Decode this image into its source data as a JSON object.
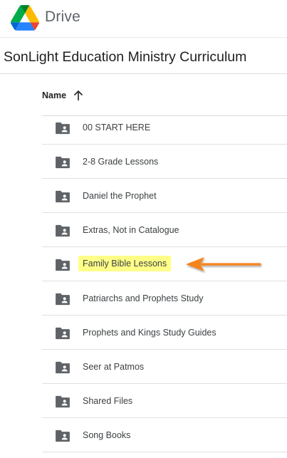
{
  "header": {
    "brand": "Drive",
    "logo_icon": "google-drive-logo"
  },
  "folder": {
    "title": "SonLight Education Ministry Curriculum"
  },
  "list": {
    "column_name": "Name",
    "sort_icon": "arrow-up-icon",
    "items": [
      {
        "name": "00 START HERE",
        "icon": "shared-folder-icon"
      },
      {
        "name": "2-8 Grade Lessons",
        "icon": "shared-folder-icon"
      },
      {
        "name": "Daniel the Prophet",
        "icon": "shared-folder-icon"
      },
      {
        "name": "Extras, Not in Catalogue",
        "icon": "shared-folder-icon"
      },
      {
        "name": "Family Bible Lessons",
        "icon": "shared-folder-icon",
        "highlighted": true
      },
      {
        "name": "Patriarchs and Prophets Study",
        "icon": "shared-folder-icon"
      },
      {
        "name": "Prophets and Kings Study Guides",
        "icon": "shared-folder-icon"
      },
      {
        "name": "Seer at Patmos",
        "icon": "shared-folder-icon"
      },
      {
        "name": "Shared Files",
        "icon": "shared-folder-icon"
      },
      {
        "name": "Song Books",
        "icon": "shared-folder-icon"
      }
    ]
  },
  "annotation": {
    "arrow_color": "#f5841f",
    "highlight_color": "#ffff88"
  }
}
